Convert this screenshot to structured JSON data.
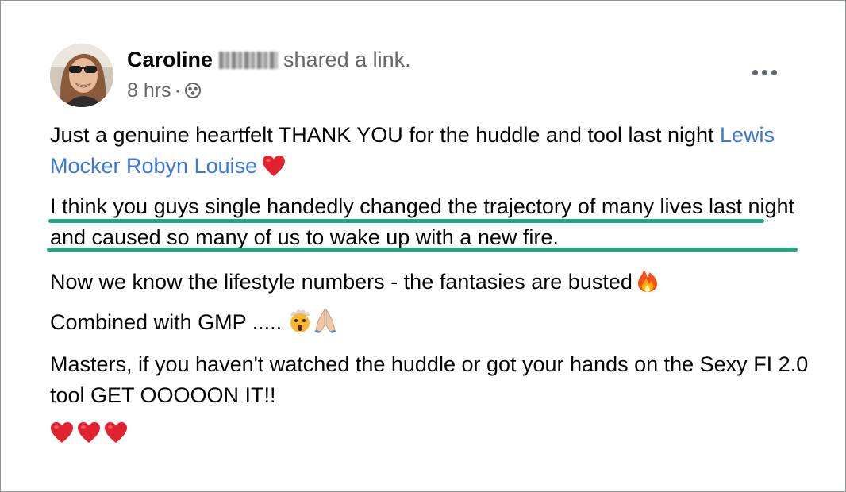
{
  "post": {
    "author_first_name": "Caroline",
    "action_text": "shared a link.",
    "time_ago": "8 hrs",
    "separator": "·",
    "audience": "group-icon",
    "more_options": "more-horizontal-icon"
  },
  "message": {
    "line1_text": "Just a genuine heartfelt THANK YOU for the huddle and tool last night",
    "mentions": [
      "Lewis Mocker",
      "Robyn Louise"
    ],
    "line1_emoji": "red-heart",
    "para2": "I think you guys single handedly changed the trajectory of many lives last night and caused so many of us to wake up with a new fire.",
    "para3": "Now we know the lifestyle numbers - the fantasies are busted",
    "para3_emoji": "fire",
    "para4": "Combined with GMP .....",
    "para4_emojis": [
      "exploding-head-face",
      "folded-hands"
    ],
    "para5": "Masters, if you haven't watched the huddle or got your hands on the Sexy FI 2.0 tool GET OOOOON IT!!",
    "closing_emojis": [
      "red-heart",
      "red-heart",
      "red-heart"
    ]
  },
  "highlight": {
    "color": "#1fa884"
  }
}
